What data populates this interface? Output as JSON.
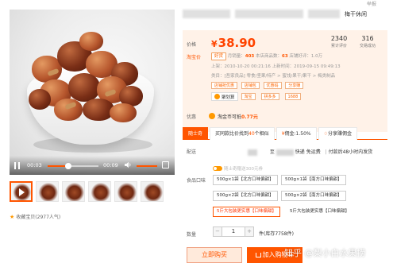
{
  "header": {
    "report": "举报"
  },
  "title": {
    "suffix": "梅干休闲"
  },
  "price": {
    "label": "价格",
    "currency": "¥",
    "value": "38.90",
    "monthly_sales": {
      "num": "2340",
      "label": "累计评价"
    },
    "reviews": {
      "num": "316",
      "label": "交易成功"
    }
  },
  "taobao_price": {
    "label": "淘宝价",
    "tag": "好货",
    "line1_prefix": "月销量：",
    "line1_num": "403",
    "line1_mid": " 本店商品数：",
    "line1_num2": "63",
    "line1_suffix": " 店铺好评：1.0万",
    "line2": "上架：2010-10-20 00:21:16 上新时间：2019-09-15 09:49:13",
    "line3": "类目：[吾家良品] 零食/坚果/特产 > 蜜饯/果干/果干 > 梅类制品",
    "tags": [
      "店铺抢优惠",
      "店铺包",
      "优惠码",
      "分享赚"
    ],
    "tuan": {
      "name": "聚划算",
      "tags": [
        "淘宝",
        "拼多多",
        "1688"
      ]
    }
  },
  "promo": {
    "label": "优惠",
    "text_prefix": "淘金币可抵",
    "amount": "0.77元"
  },
  "tabs": [
    {
      "label": "随士奇"
    },
    {
      "label": "买同款比价找到",
      "count": "40",
      "suffix": "个相似"
    },
    {
      "label": "佣金:1.50%"
    },
    {
      "label": "分享赚佣金"
    }
  ],
  "shipping": {
    "label": "配送",
    "mid": "快递 免运费",
    "suffix": "付款后48小时内发货",
    "arrow": "至"
  },
  "sku": {
    "label": "食品口味",
    "promo_hint": "随士奇赠送300元券",
    "options": [
      "500g×1袋【北方口味偏甜】",
      "500g×1袋【南方口味偏甜】",
      "500g×2袋【北方口味偏甜】",
      "500g×2袋【南方口味偏甜】",
      "5斤大包装更实惠【口味偏甜】",
      "5斤大包装更实惠【口味偏甜】"
    ]
  },
  "quantity": {
    "label": "数量",
    "value": "1",
    "stock": "件(库存7758件)"
  },
  "buttons": {
    "buy": "立即购买",
    "cart": "加入购物车"
  },
  "video": {
    "current": "00:03",
    "duration": "00:09",
    "progress": 0.4
  },
  "footer": {
    "fav": "收藏宝贝",
    "fav_count": "(2977人气)"
  },
  "watermark": "知乎 @梨小白水果捞",
  "colors": {
    "accent": "#ff5500",
    "price": "#ff4400",
    "panel": "#fff2e8"
  }
}
